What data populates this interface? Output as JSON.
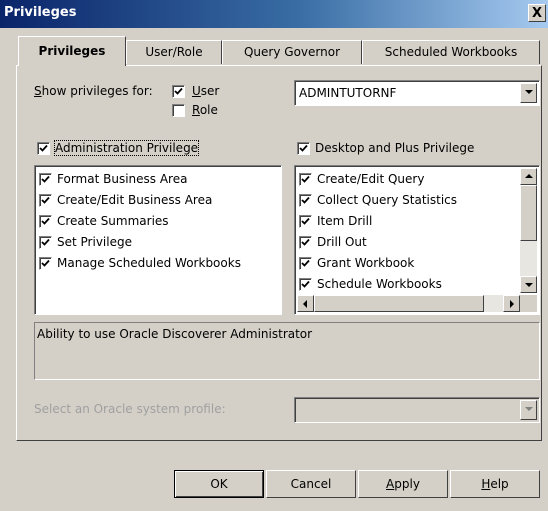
{
  "window": {
    "title": "Privileges",
    "close_label": "X"
  },
  "tabs": [
    {
      "label": "Privileges",
      "active": true
    },
    {
      "label": "User/Role",
      "active": false
    },
    {
      "label": "Query Governor",
      "active": false
    },
    {
      "label": "Scheduled Workbooks",
      "active": false
    }
  ],
  "show_for": {
    "label_prefix": "S",
    "label_rest": "how privileges for:",
    "user_prefix": "U",
    "user_rest": "ser",
    "user_checked": true,
    "role_prefix": "R",
    "role_rest": "ole",
    "role_checked": false,
    "selected_value": "ADMINTUTORNF"
  },
  "admin_privilege": {
    "label": "Administration Privilege",
    "checked": true,
    "items": [
      {
        "label": "Format Business Area",
        "checked": true
      },
      {
        "label": "Create/Edit Business Area",
        "checked": true
      },
      {
        "label": "Create Summaries",
        "checked": true
      },
      {
        "label": "Set Privilege",
        "checked": true
      },
      {
        "label": "Manage Scheduled Workbooks",
        "checked": true
      }
    ]
  },
  "desktop_privilege": {
    "label": "Desktop and Plus Privilege",
    "checked": true,
    "items": [
      {
        "label": "Create/Edit Query",
        "checked": true
      },
      {
        "label": "Collect Query Statistics",
        "checked": true
      },
      {
        "label": "Item Drill",
        "checked": true
      },
      {
        "label": "Drill Out",
        "checked": true
      },
      {
        "label": "Grant Workbook",
        "checked": true
      },
      {
        "label": "Schedule Workbooks",
        "checked": true
      }
    ]
  },
  "description": "Ability to use Oracle Discoverer Administrator",
  "system_profile": {
    "label": "Select an Oracle system profile:",
    "value": ""
  },
  "buttons": {
    "ok": "OK",
    "cancel": "Cancel",
    "apply_prefix": "A",
    "apply_rest": "pply",
    "help_prefix": "H",
    "help_rest": "elp"
  }
}
